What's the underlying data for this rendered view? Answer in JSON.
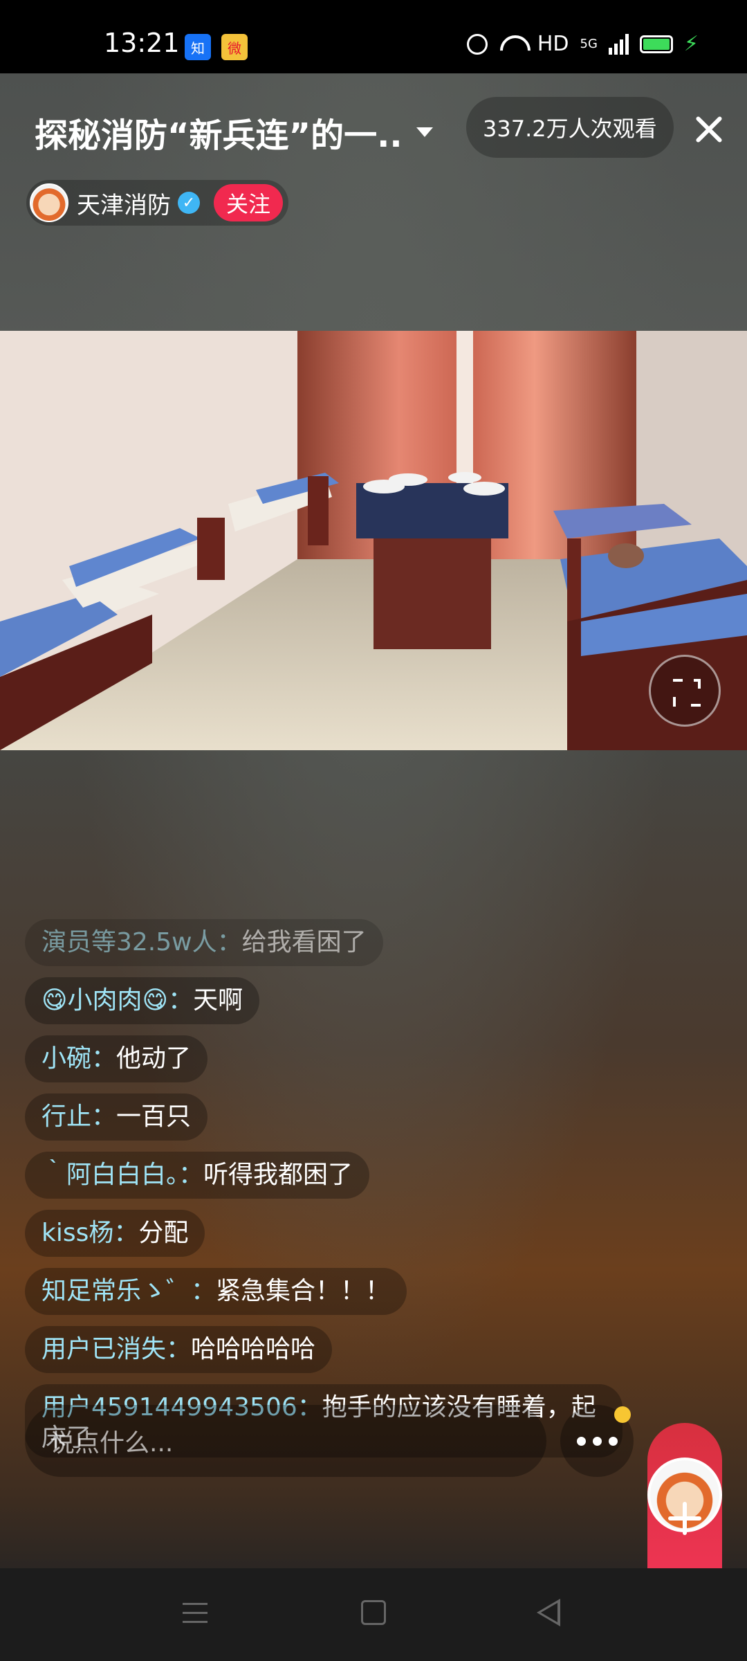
{
  "status_bar": {
    "time": "13:21",
    "apps": [
      "知",
      "微"
    ],
    "hd": "HD",
    "network": "5G",
    "icons": [
      "alarm-icon",
      "wifi-icon",
      "signal-icon",
      "battery-icon",
      "charging-icon"
    ]
  },
  "header": {
    "title": "探秘消防“新兵连”的一..",
    "viewers": "337.2万人次观看",
    "streamer_name": "天津消防",
    "follow_label": "关注"
  },
  "comments": [
    {
      "user": "演员等32.5w人：",
      "text": "给我看困了"
    },
    {
      "user": "😋小肉肉😋：",
      "text": "天啊"
    },
    {
      "user": "小碗：",
      "text": "他动了"
    },
    {
      "user": "行止：",
      "text": "一百只"
    },
    {
      "user": "｀阿白白白。：",
      "text": "听得我都困了"
    },
    {
      "user": "kiss杨：",
      "text": "分配"
    },
    {
      "user": "知足常乐ゝ゛：",
      "text": "紧急集合！！！"
    },
    {
      "user": "用户已消失：",
      "text": "哈哈哈哈哈"
    },
    {
      "user": "用户4591449943506：",
      "text": "抱手的应该没有睡着，起床了"
    }
  ],
  "input": {
    "placeholder": "说点什么..."
  },
  "colors": {
    "follow": "#f1294f",
    "username": "#9fe4f6",
    "gift": "#f6365a",
    "notify_dot": "#f7c632"
  }
}
